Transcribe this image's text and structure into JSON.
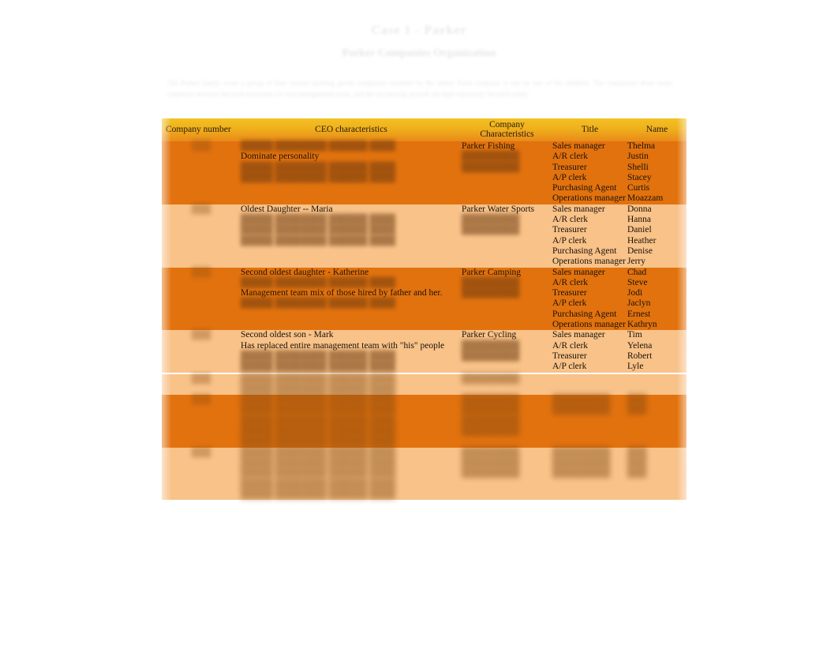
{
  "document": {
    "title": "Case 1 - Parker",
    "subtitle": "Parker Companies Organization",
    "paragraph": "The Parker family owns a group of four related sporting goods companies founded by the father. Each company is run by one of his children. The companies share some corporate services but each maintains its own management team, and the accounting records are kept separately for each entity."
  },
  "table": {
    "headers": [
      "Company number",
      "CEO characteristics",
      "Company Characteristics",
      "Title",
      "Name"
    ],
    "rows": [
      {
        "shade": "dark",
        "company_number": "",
        "company_number_redacted": true,
        "ceo_lines": [
          {
            "text": "",
            "redacted": true
          },
          {
            "text": "Dominate personality",
            "redacted": false
          },
          {
            "text": "",
            "redacted": true
          },
          {
            "text": "",
            "redacted": true
          }
        ],
        "company": "Parker Fishing",
        "company_redacted_lines": [
          {
            "text": "",
            "redacted": true
          },
          {
            "text": "",
            "redacted": true
          }
        ],
        "staff": [
          {
            "title": "Sales manager",
            "name": "Thelma"
          },
          {
            "title": "A/R clerk",
            "name": "Justin"
          },
          {
            "title": "Treasurer",
            "name": "Shelli"
          },
          {
            "title": "A/P clerk",
            "name": "Stacey"
          },
          {
            "title": "Purchasing Agent",
            "name": "Curtis"
          },
          {
            "title": "Operations manager",
            "name": "Moazzam"
          }
        ]
      },
      {
        "shade": "light",
        "company_number": "",
        "company_number_redacted": true,
        "ceo_lines": [
          {
            "text": "Oldest Daughter  -- Maria",
            "redacted": false
          },
          {
            "text": "",
            "redacted": true
          },
          {
            "text": "",
            "redacted": true
          },
          {
            "text": "",
            "redacted": true
          }
        ],
        "company": "Parker Water Sports",
        "company_redacted_lines": [
          {
            "text": "",
            "redacted": true
          },
          {
            "text": "",
            "redacted": true
          }
        ],
        "staff": [
          {
            "title": "Sales manager",
            "name": "Donna"
          },
          {
            "title": "A/R clerk",
            "name": "Hanna"
          },
          {
            "title": "Treasurer",
            "name": "Daniel"
          },
          {
            "title": "A/P clerk",
            "name": "Heather"
          },
          {
            "title": "Purchasing Agent",
            "name": "Denise"
          },
          {
            "title": "Operations manager",
            "name": "Jerry"
          }
        ]
      },
      {
        "shade": "dark",
        "company_number": "",
        "company_number_redacted": true,
        "ceo_lines": [
          {
            "text": "Second oldest daughter  - Katherine",
            "redacted": false
          },
          {
            "text": "",
            "redacted": true
          },
          {
            "text": "Management team mix of those hired by father and her.",
            "redacted": false
          },
          {
            "text": "",
            "redacted": true
          }
        ],
        "company": "Parker Camping",
        "company_redacted_lines": [
          {
            "text": "",
            "redacted": true
          },
          {
            "text": "",
            "redacted": true
          }
        ],
        "staff": [
          {
            "title": "Sales manager",
            "name": "Chad"
          },
          {
            "title": "A/R clerk",
            "name": "Steve"
          },
          {
            "title": "Treasurer",
            "name": "Jodi"
          },
          {
            "title": "A/P clerk",
            "name": "Jaclyn"
          },
          {
            "title": "Purchasing Agent",
            "name": "Ernest"
          },
          {
            "title": "Operations manager",
            "name": "Kathryn"
          }
        ]
      },
      {
        "shade": "light",
        "company_number": "",
        "company_number_redacted": true,
        "ceo_lines": [
          {
            "text": "Second oldest son  - Mark",
            "redacted": false
          },
          {
            "text": "Has replaced entire management team with \"his\" people",
            "redacted": false
          },
          {
            "text": "",
            "redacted": true
          },
          {
            "text": "",
            "redacted": true
          }
        ],
        "company": "Parker Cycling",
        "company_redacted_lines": [
          {
            "text": "",
            "redacted": true
          },
          {
            "text": "",
            "redacted": true
          }
        ],
        "staff": [
          {
            "title": "Sales manager",
            "name": "Tim"
          },
          {
            "title": "A/R clerk",
            "name": "Yelena"
          },
          {
            "title": "Treasurer",
            "name": "Robert"
          },
          {
            "title": "A/P clerk",
            "name": "Lyle"
          }
        ]
      },
      {
        "shade": "light",
        "company_number": "",
        "company_number_redacted": true,
        "ceo_lines": [
          {
            "text": "",
            "redacted": true
          },
          {
            "text": "",
            "redacted": true
          }
        ],
        "company": "",
        "company_redacted": true,
        "company_redacted_lines": [],
        "staff": []
      },
      {
        "shade": "dark",
        "company_number": "",
        "company_number_redacted": true,
        "ceo_lines": [
          {
            "text": "",
            "redacted": true
          },
          {
            "text": "",
            "redacted": true
          },
          {
            "text": "",
            "redacted": true
          },
          {
            "text": "",
            "redacted": true
          },
          {
            "text": "",
            "redacted": true
          }
        ],
        "company": "",
        "company_redacted": true,
        "company_redacted_lines": [
          {
            "text": "",
            "redacted": true
          },
          {
            "text": "",
            "redacted": true
          },
          {
            "text": "",
            "redacted": true
          }
        ],
        "staff": [
          {
            "title": "",
            "name": "",
            "redacted": true
          },
          {
            "title": "",
            "name": "",
            "redacted": true
          }
        ]
      },
      {
        "shade": "light",
        "company_number": "",
        "company_number_redacted": true,
        "ceo_lines": [
          {
            "text": "",
            "redacted": true
          },
          {
            "text": "",
            "redacted": true
          },
          {
            "text": "",
            "redacted": true
          },
          {
            "text": "",
            "redacted": true
          },
          {
            "text": "",
            "redacted": true
          }
        ],
        "company": "",
        "company_redacted": true,
        "company_redacted_lines": [
          {
            "text": "",
            "redacted": true
          },
          {
            "text": "",
            "redacted": true
          }
        ],
        "staff": [
          {
            "title": "",
            "name": "",
            "redacted": true
          },
          {
            "title": "",
            "name": "",
            "redacted": true
          },
          {
            "title": "",
            "name": "",
            "redacted": true
          }
        ]
      }
    ]
  },
  "colors": {
    "row_dark": "#E2720E",
    "row_light": "#F8C289",
    "header_top": "#F3C022",
    "header_bottom": "#E8891A",
    "text": "#1A1208",
    "page_background": "#FFFFFF"
  }
}
